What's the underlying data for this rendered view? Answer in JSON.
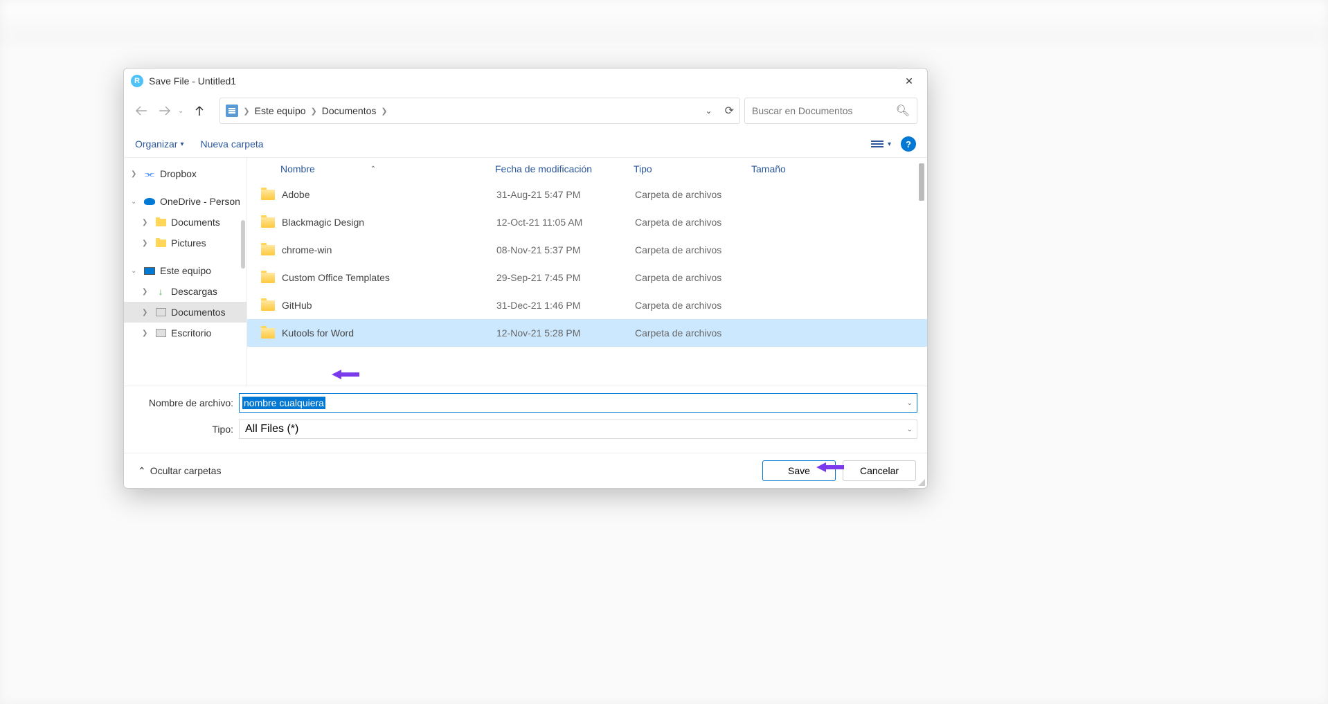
{
  "dialog": {
    "title": "Save File - Untitled1",
    "titlebar_icon_letter": "R"
  },
  "breadcrumb": {
    "items": [
      "Este equipo",
      "Documentos"
    ]
  },
  "search": {
    "placeholder": "Buscar en Documentos"
  },
  "toolbar": {
    "organize": "Organizar",
    "new_folder": "Nueva carpeta"
  },
  "sidebar": {
    "items": [
      {
        "label": "Dropbox",
        "icon": "dropbox",
        "expanded": false,
        "indent": 0
      },
      {
        "label": "OneDrive - Person",
        "icon": "onedrive",
        "expanded": true,
        "indent": 0
      },
      {
        "label": "Documents",
        "icon": "folder",
        "expanded": false,
        "indent": 1
      },
      {
        "label": "Pictures",
        "icon": "folder",
        "expanded": false,
        "indent": 1
      },
      {
        "label": "Este equipo",
        "icon": "pc",
        "expanded": true,
        "indent": 0
      },
      {
        "label": "Descargas",
        "icon": "download",
        "expanded": false,
        "indent": 1
      },
      {
        "label": "Documentos",
        "icon": "disk",
        "expanded": false,
        "indent": 1,
        "selected": true
      },
      {
        "label": "Escritorio",
        "icon": "disk",
        "expanded": false,
        "indent": 1
      }
    ]
  },
  "columns": {
    "name": "Nombre",
    "modified": "Fecha de modificación",
    "type": "Tipo",
    "size": "Tamaño"
  },
  "files": [
    {
      "name": "Adobe",
      "date": "31-Aug-21 5:47 PM",
      "type": "Carpeta de archivos"
    },
    {
      "name": "Blackmagic Design",
      "date": "12-Oct-21 11:05 AM",
      "type": "Carpeta de archivos"
    },
    {
      "name": "chrome-win",
      "date": "08-Nov-21 5:37 PM",
      "type": "Carpeta de archivos"
    },
    {
      "name": "Custom Office Templates",
      "date": "29-Sep-21 7:45 PM",
      "type": "Carpeta de archivos"
    },
    {
      "name": "GitHub",
      "date": "31-Dec-21 1:46 PM",
      "type": "Carpeta de archivos"
    },
    {
      "name": "Kutools for Word",
      "date": "12-Nov-21 5:28 PM",
      "type": "Carpeta de archivos",
      "selected": true
    }
  ],
  "fields": {
    "filename_label": "Nombre de archivo:",
    "filename_value": "nombre cualquiera",
    "type_label": "Tipo:",
    "type_value": "All Files  (*)"
  },
  "footer": {
    "hide_folders": "Ocultar carpetas",
    "save": "Save",
    "cancel": "Cancelar"
  }
}
